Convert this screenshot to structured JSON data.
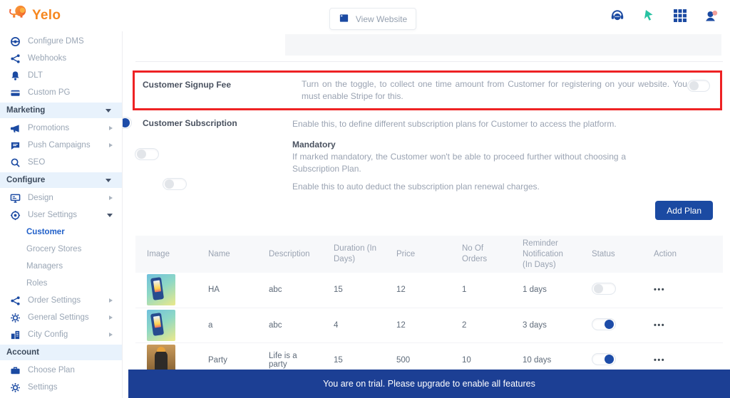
{
  "header": {
    "logo_text": "Yelo",
    "view_website": "View Website"
  },
  "sidebar": {
    "entries": [
      {
        "type": "item",
        "label": "Configure DMS",
        "icon": "dms"
      },
      {
        "type": "item",
        "label": "Webhooks",
        "icon": "webhooks"
      },
      {
        "type": "item",
        "label": "DLT",
        "icon": "bell"
      },
      {
        "type": "item",
        "label": "Custom PG",
        "icon": "payment"
      },
      {
        "type": "section",
        "label": "Marketing",
        "chevron": "down"
      },
      {
        "type": "item",
        "label": "Promotions",
        "icon": "megaphone",
        "chevron": "right"
      },
      {
        "type": "item",
        "label": "Push Campaigns",
        "icon": "chat",
        "chevron": "right"
      },
      {
        "type": "item",
        "label": "SEO",
        "icon": "search"
      },
      {
        "type": "section",
        "label": "Configure",
        "chevron": "down"
      },
      {
        "type": "item",
        "label": "Design",
        "icon": "monitor",
        "chevron": "right"
      },
      {
        "type": "item",
        "label": "User Settings",
        "icon": "target",
        "chevron": "down"
      },
      {
        "type": "sub",
        "label": "Customer",
        "selected": true
      },
      {
        "type": "sub",
        "label": "Grocery Stores"
      },
      {
        "type": "sub",
        "label": "Managers"
      },
      {
        "type": "sub",
        "label": "Roles"
      },
      {
        "type": "item",
        "label": "Order Settings",
        "icon": "webhooks",
        "chevron": "right"
      },
      {
        "type": "item",
        "label": "General Settings",
        "icon": "gear",
        "chevron": "right"
      },
      {
        "type": "item",
        "label": "City Config",
        "icon": "building",
        "chevron": "right"
      },
      {
        "type": "section",
        "label": "Account"
      },
      {
        "type": "item",
        "label": "Choose Plan",
        "icon": "briefcase"
      },
      {
        "type": "item",
        "label": "Settings",
        "icon": "gear"
      }
    ]
  },
  "main": {
    "signup_fee": {
      "title": "Customer Signup Fee",
      "description": "Turn on the toggle, to collect one time amount from Customer for registering on your website. You must enable Stripe for this.",
      "toggle_on": false
    },
    "subscription": {
      "title": "Customer Subscription",
      "description": "Enable this, to define different subscription plans for Customer to access the platform.",
      "toggle_on": true,
      "mandatory": {
        "title": "Mandatory",
        "description": "If marked mandatory, the Customer won't be able to proceed further without choosing a Subscription Plan.",
        "toggle_on": false
      },
      "auto_deduct": {
        "description": "Enable this to auto deduct the subscription plan renewal charges.",
        "toggle_on": false
      },
      "add_plan_label": "Add Plan"
    },
    "plans_table": {
      "columns": [
        "Image",
        "Name",
        "Description",
        "Duration (In Days)",
        "Price",
        "No Of Orders",
        "Reminder Notification (In Days)",
        "Status",
        "Action"
      ],
      "rows": [
        {
          "image": "phone",
          "name": "HA",
          "description": "abc",
          "duration": "15",
          "price": "12",
          "orders": "1",
          "reminder": "1 days",
          "status": false
        },
        {
          "image": "phone",
          "name": "a",
          "description": "abc",
          "duration": "4",
          "price": "12",
          "orders": "2",
          "reminder": "3 days",
          "status": true
        },
        {
          "image": "person",
          "name": "Party",
          "description": "Life is a party",
          "duration": "15",
          "price": "500",
          "orders": "10",
          "reminder": "10 days",
          "status": true
        }
      ]
    }
  },
  "banner": {
    "text": "You are on trial. Please upgrade to enable all features"
  },
  "colors": {
    "primary": "#1b4aa2",
    "accent_orange": "#f6871f",
    "highlight_red": "#ee2224",
    "banner_blue": "#1c3f94",
    "green": "#27c2a2"
  }
}
